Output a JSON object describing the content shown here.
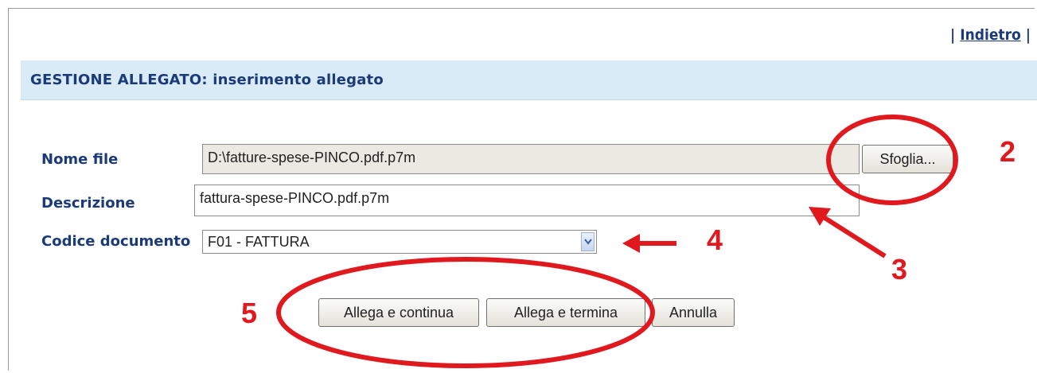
{
  "nav": {
    "sep_left": "|",
    "back_link": "Indietro",
    "sep_right": "|"
  },
  "header": {
    "title": "GESTIONE ALLEGATO: inserimento allegato"
  },
  "form": {
    "file_label": "Nome file",
    "file_value": "D:\\fatture-spese-PINCO.pdf.p7m",
    "browse_button": "Sfoglia...",
    "description_label": "Descrizione",
    "description_value": "fattura-spese-PINCO.pdf.p7m",
    "doc_code_label": "Codice documento",
    "doc_code_value": "F01 - FATTURA"
  },
  "actions": {
    "attach_continue": "Allega e continua",
    "attach_finish": "Allega e termina",
    "cancel": "Annulla"
  },
  "annotations": {
    "color": "#e0191f",
    "labels": [
      "2",
      "3",
      "4",
      "5"
    ]
  }
}
